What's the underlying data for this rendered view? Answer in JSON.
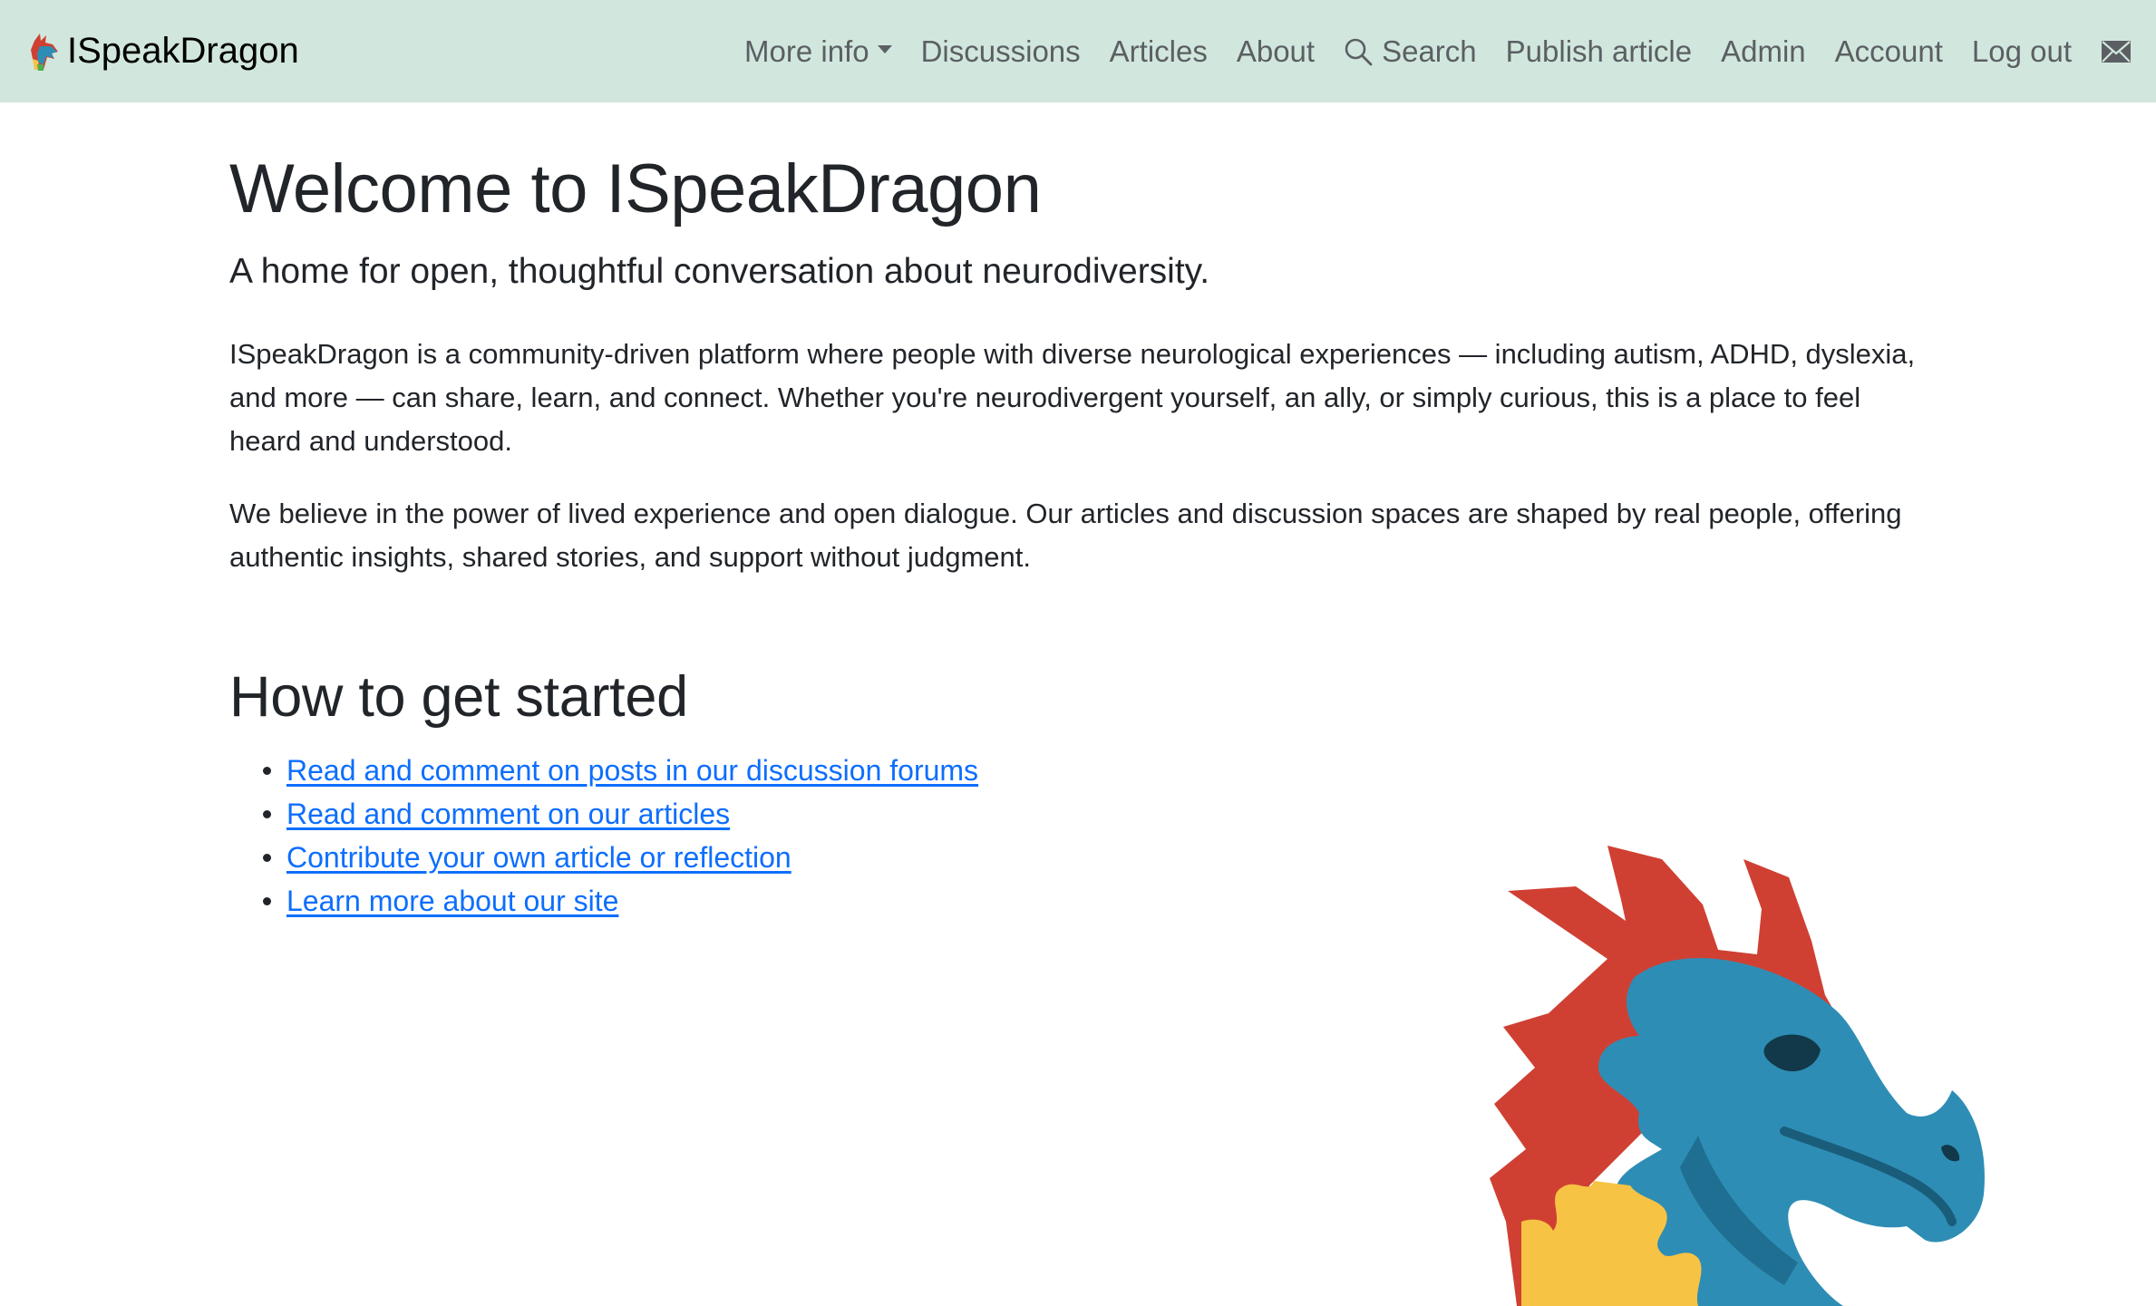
{
  "brand": {
    "name": "ISpeakDragon"
  },
  "nav": {
    "more_info": "More info",
    "discussions": "Discussions",
    "articles": "Articles",
    "about": "About",
    "search": "Search",
    "publish": "Publish article",
    "admin": "Admin",
    "account": "Account",
    "logout": "Log out"
  },
  "main": {
    "title": "Welcome to ISpeakDragon",
    "lead": "A home for open, thoughtful conversation about neurodiversity.",
    "paragraphs": [
      "ISpeakDragon is a community-driven platform where people with diverse neurological experiences — including autism, ADHD, dyslexia, and more — can share, learn, and connect. Whether you're neurodivergent yourself, an ally, or simply curious, this is a place to feel heard and understood.",
      "We believe in the power of lived experience and open dialogue. Our articles and discussion spaces are shaped by real people, offering authentic insights, shared stories, and support without judgment."
    ],
    "section_title": "How to get started",
    "links": [
      "Read and comment on posts in our discussion forums",
      "Read and comment on our articles",
      "Contribute your own article or reflection",
      "Learn more about our site"
    ]
  },
  "colors": {
    "navbar_bg": "#d1e7dd",
    "link": "#0d6efd",
    "dragon_red": "#cf4033",
    "dragon_blue": "#2e8db5",
    "dragon_yellow": "#f7c344"
  }
}
